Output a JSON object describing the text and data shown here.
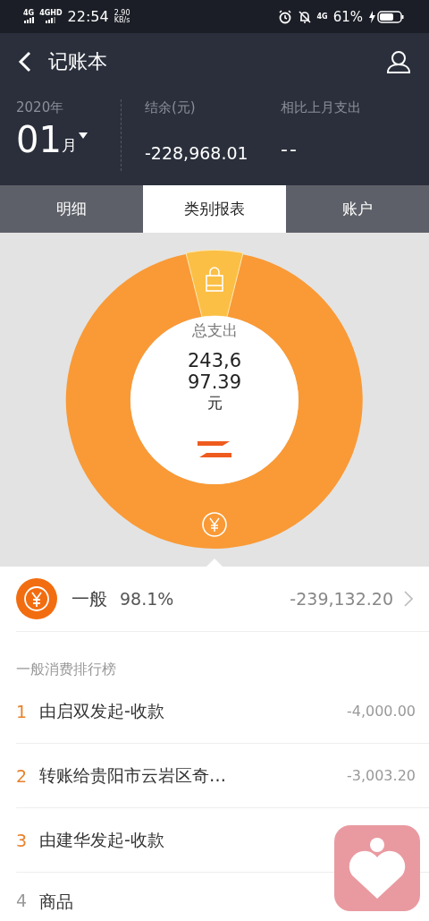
{
  "status_bar": {
    "network_1": "4G",
    "network_2": "4GHD",
    "time": "22:54",
    "speed": "2.90",
    "speed_unit": "KB/s",
    "network_3": "4G",
    "battery": "61%"
  },
  "header": {
    "title": "记账本",
    "year": "2020年",
    "month": "01",
    "month_unit": "月",
    "balance_label": "结余(元)",
    "balance": "-228,968.01",
    "compare_label": "相比上月支出",
    "compare_value": "--"
  },
  "tabs": [
    {
      "label": "明细",
      "selected": false
    },
    {
      "label": "类别报表",
      "selected": true
    },
    {
      "label": "账户",
      "selected": false
    }
  ],
  "donut": {
    "center_label": "总支出",
    "total": "243,697.39",
    "unit": "元"
  },
  "category": {
    "name": "一般",
    "percent": "98.1%",
    "amount": "-239,132.20"
  },
  "ranking": {
    "title": "一般消费排行榜",
    "items": [
      {
        "rank": "1",
        "name": "由启双发起-收款",
        "amount": "-4,000.00",
        "highlighted": true
      },
      {
        "rank": "2",
        "name": "转账给贵阳市云岩区奇…",
        "amount": "-3,003.20",
        "highlighted": true
      },
      {
        "rank": "3",
        "name": "由建华发起-收款",
        "highlighted": true
      },
      {
        "rank": "4",
        "name": "商品",
        "highlighted": false
      }
    ]
  }
}
